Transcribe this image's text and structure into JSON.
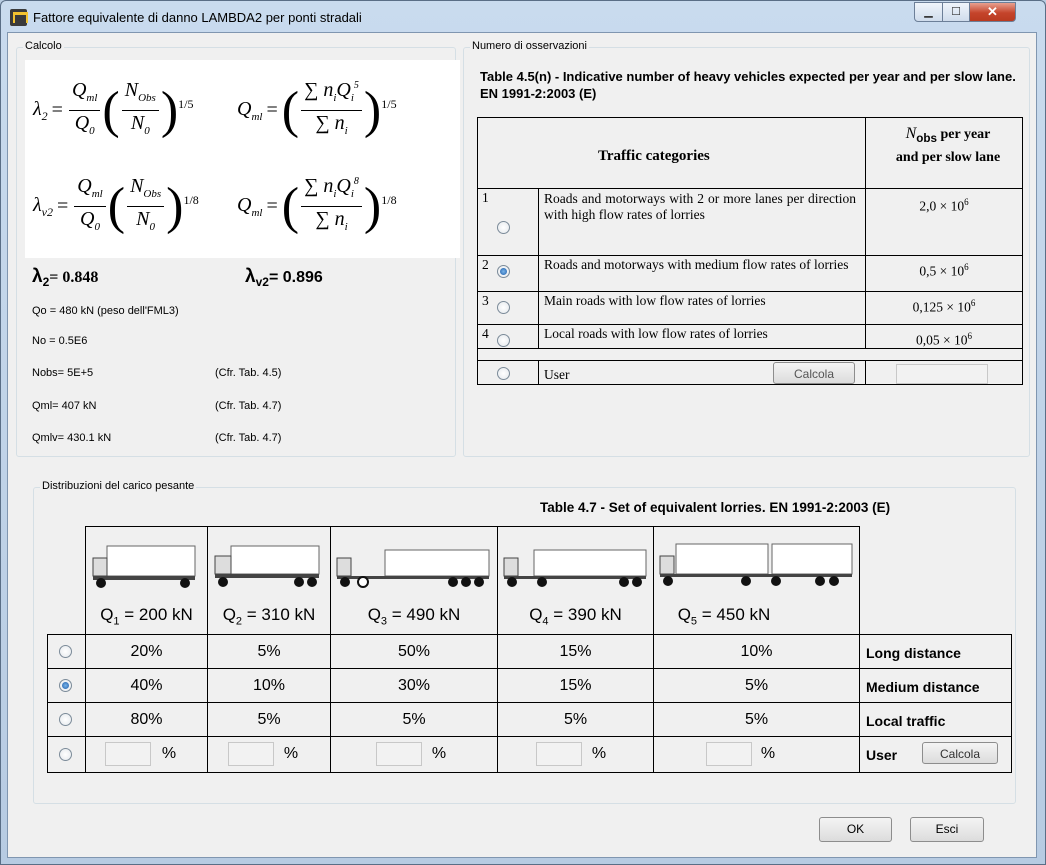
{
  "window": {
    "title": "Fattore equivalente di danno LAMBDA2 per ponti stradali"
  },
  "calcolo": {
    "group_label": "Calcolo",
    "lambda2_label": "λ",
    "lambda2_sub": "2",
    "lambda2_value": "= 0.848",
    "lambdav2_label": "λ",
    "lambdav2_sub": "v2",
    "lambdav2_value": "= 0.896",
    "qo": "Qo = 480 kN (peso dell'FML3)",
    "no": "No = 0.5E6",
    "nobs": "Nobs= 5E+5",
    "nobs_ref": "(Cfr. Tab. 4.5)",
    "qml": "Qml= 407 kN",
    "qml_ref": "(Cfr. Tab. 4.7)",
    "qmlv": "Qmlv= 430.1 kN",
    "qmlv_ref": "(Cfr. Tab. 4.7)"
  },
  "numero": {
    "group_label": "Numero di osservazioni",
    "table_title": "Table 4.5(n) - Indicative number of heavy vehicles expected per year and per slow lane.  EN 1991-2:2003 (E)",
    "header_categories": "Traffic categories",
    "header_nobs_symbol": "N",
    "header_nobs_sub": "obs",
    "header_nobs_rest": " per year",
    "header_nobs_line2": "and per slow lane",
    "rows": [
      {
        "num": "1",
        "text": "Roads and motorways with 2 or more lanes per direction with high flow rates of lorries",
        "mant": "2,0 × 10",
        "exp": "6",
        "selected": false
      },
      {
        "num": "2",
        "text": "Roads and motorways with medium flow rates of lorries",
        "mant": "0,5 × 10",
        "exp": "6",
        "selected": true
      },
      {
        "num": "3",
        "text": "Main roads with low flow rates of lorries",
        "mant": "0,125 × 10",
        "exp": "6",
        "selected": false
      },
      {
        "num": "4",
        "text": "Local roads with low flow rates of lorries",
        "mant": "0,05 × 10",
        "exp": "6",
        "selected": false
      }
    ],
    "user_label": "User",
    "calcola_label": "Calcola",
    "user_value": ""
  },
  "distrib": {
    "group_label": "Distribuzioni del carico pesante",
    "table_title": "Table 4.7 - Set of equivalent lorries.  EN 1991-2:2003 (E)",
    "lorries": [
      {
        "q": "Q",
        "sub": "1",
        "val": " = 200 kN"
      },
      {
        "q": "Q",
        "sub": "2",
        "val": " = 310 kN"
      },
      {
        "q": "Q",
        "sub": "3",
        "val": " = 490 kN"
      },
      {
        "q": "Q",
        "sub": "4",
        "val": " = 390 kN"
      },
      {
        "q": "Q",
        "sub": "5",
        "val": " = 450 kN"
      }
    ],
    "rows": [
      {
        "label": "Long distance",
        "values": [
          "20%",
          "5%",
          "50%",
          "15%",
          "10%"
        ],
        "selected": false
      },
      {
        "label": "Medium distance",
        "values": [
          "40%",
          "10%",
          "30%",
          "15%",
          "5%"
        ],
        "selected": true
      },
      {
        "label": "Local traffic",
        "values": [
          "80%",
          "5%",
          "5%",
          "5%",
          "5%"
        ],
        "selected": false
      }
    ],
    "user_label": "User",
    "calcola_label": "Calcola",
    "pct_symbol": "%",
    "user_values": [
      "",
      "",
      "",
      "",
      ""
    ]
  },
  "buttons": {
    "ok": "OK",
    "esci": "Esci"
  }
}
